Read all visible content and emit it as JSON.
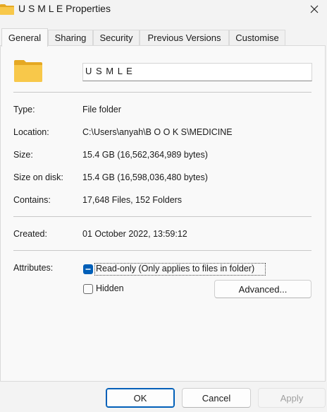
{
  "window": {
    "title": "U S M L E Properties",
    "close_icon": "close-icon",
    "folder_icon": "folder-icon"
  },
  "tabs": [
    {
      "label": "General",
      "active": true
    },
    {
      "label": "Sharing",
      "active": false
    },
    {
      "label": "Security",
      "active": false
    },
    {
      "label": "Previous Versions",
      "active": false
    },
    {
      "label": "Customise",
      "active": false
    }
  ],
  "general": {
    "folder_name": "U S M L E",
    "properties": [
      {
        "label": "Type:",
        "value": "File folder"
      },
      {
        "label": "Location:",
        "value": "C:\\Users\\anyah\\B O O K S\\MEDICINE"
      },
      {
        "label": "Size:",
        "value": "15.4 GB (16,562,364,989 bytes)"
      },
      {
        "label": "Size on disk:",
        "value": "15.4 GB (16,598,036,480 bytes)"
      },
      {
        "label": "Contains:",
        "value": "17,648 Files, 152 Folders"
      }
    ],
    "created": {
      "label": "Created:",
      "value": "01 October 2022, 13:59:12"
    },
    "attributes": {
      "label": "Attributes:",
      "read_only": {
        "label": "Read-only (Only applies to files in folder)",
        "checked": true
      },
      "hidden": {
        "label": "Hidden",
        "checked": false
      },
      "advanced_button": "Advanced..."
    }
  },
  "footer": {
    "ok": "OK",
    "cancel": "Cancel",
    "apply": "Apply"
  },
  "colors": {
    "accent": "#005fb8",
    "folder": "#f8c84a"
  }
}
